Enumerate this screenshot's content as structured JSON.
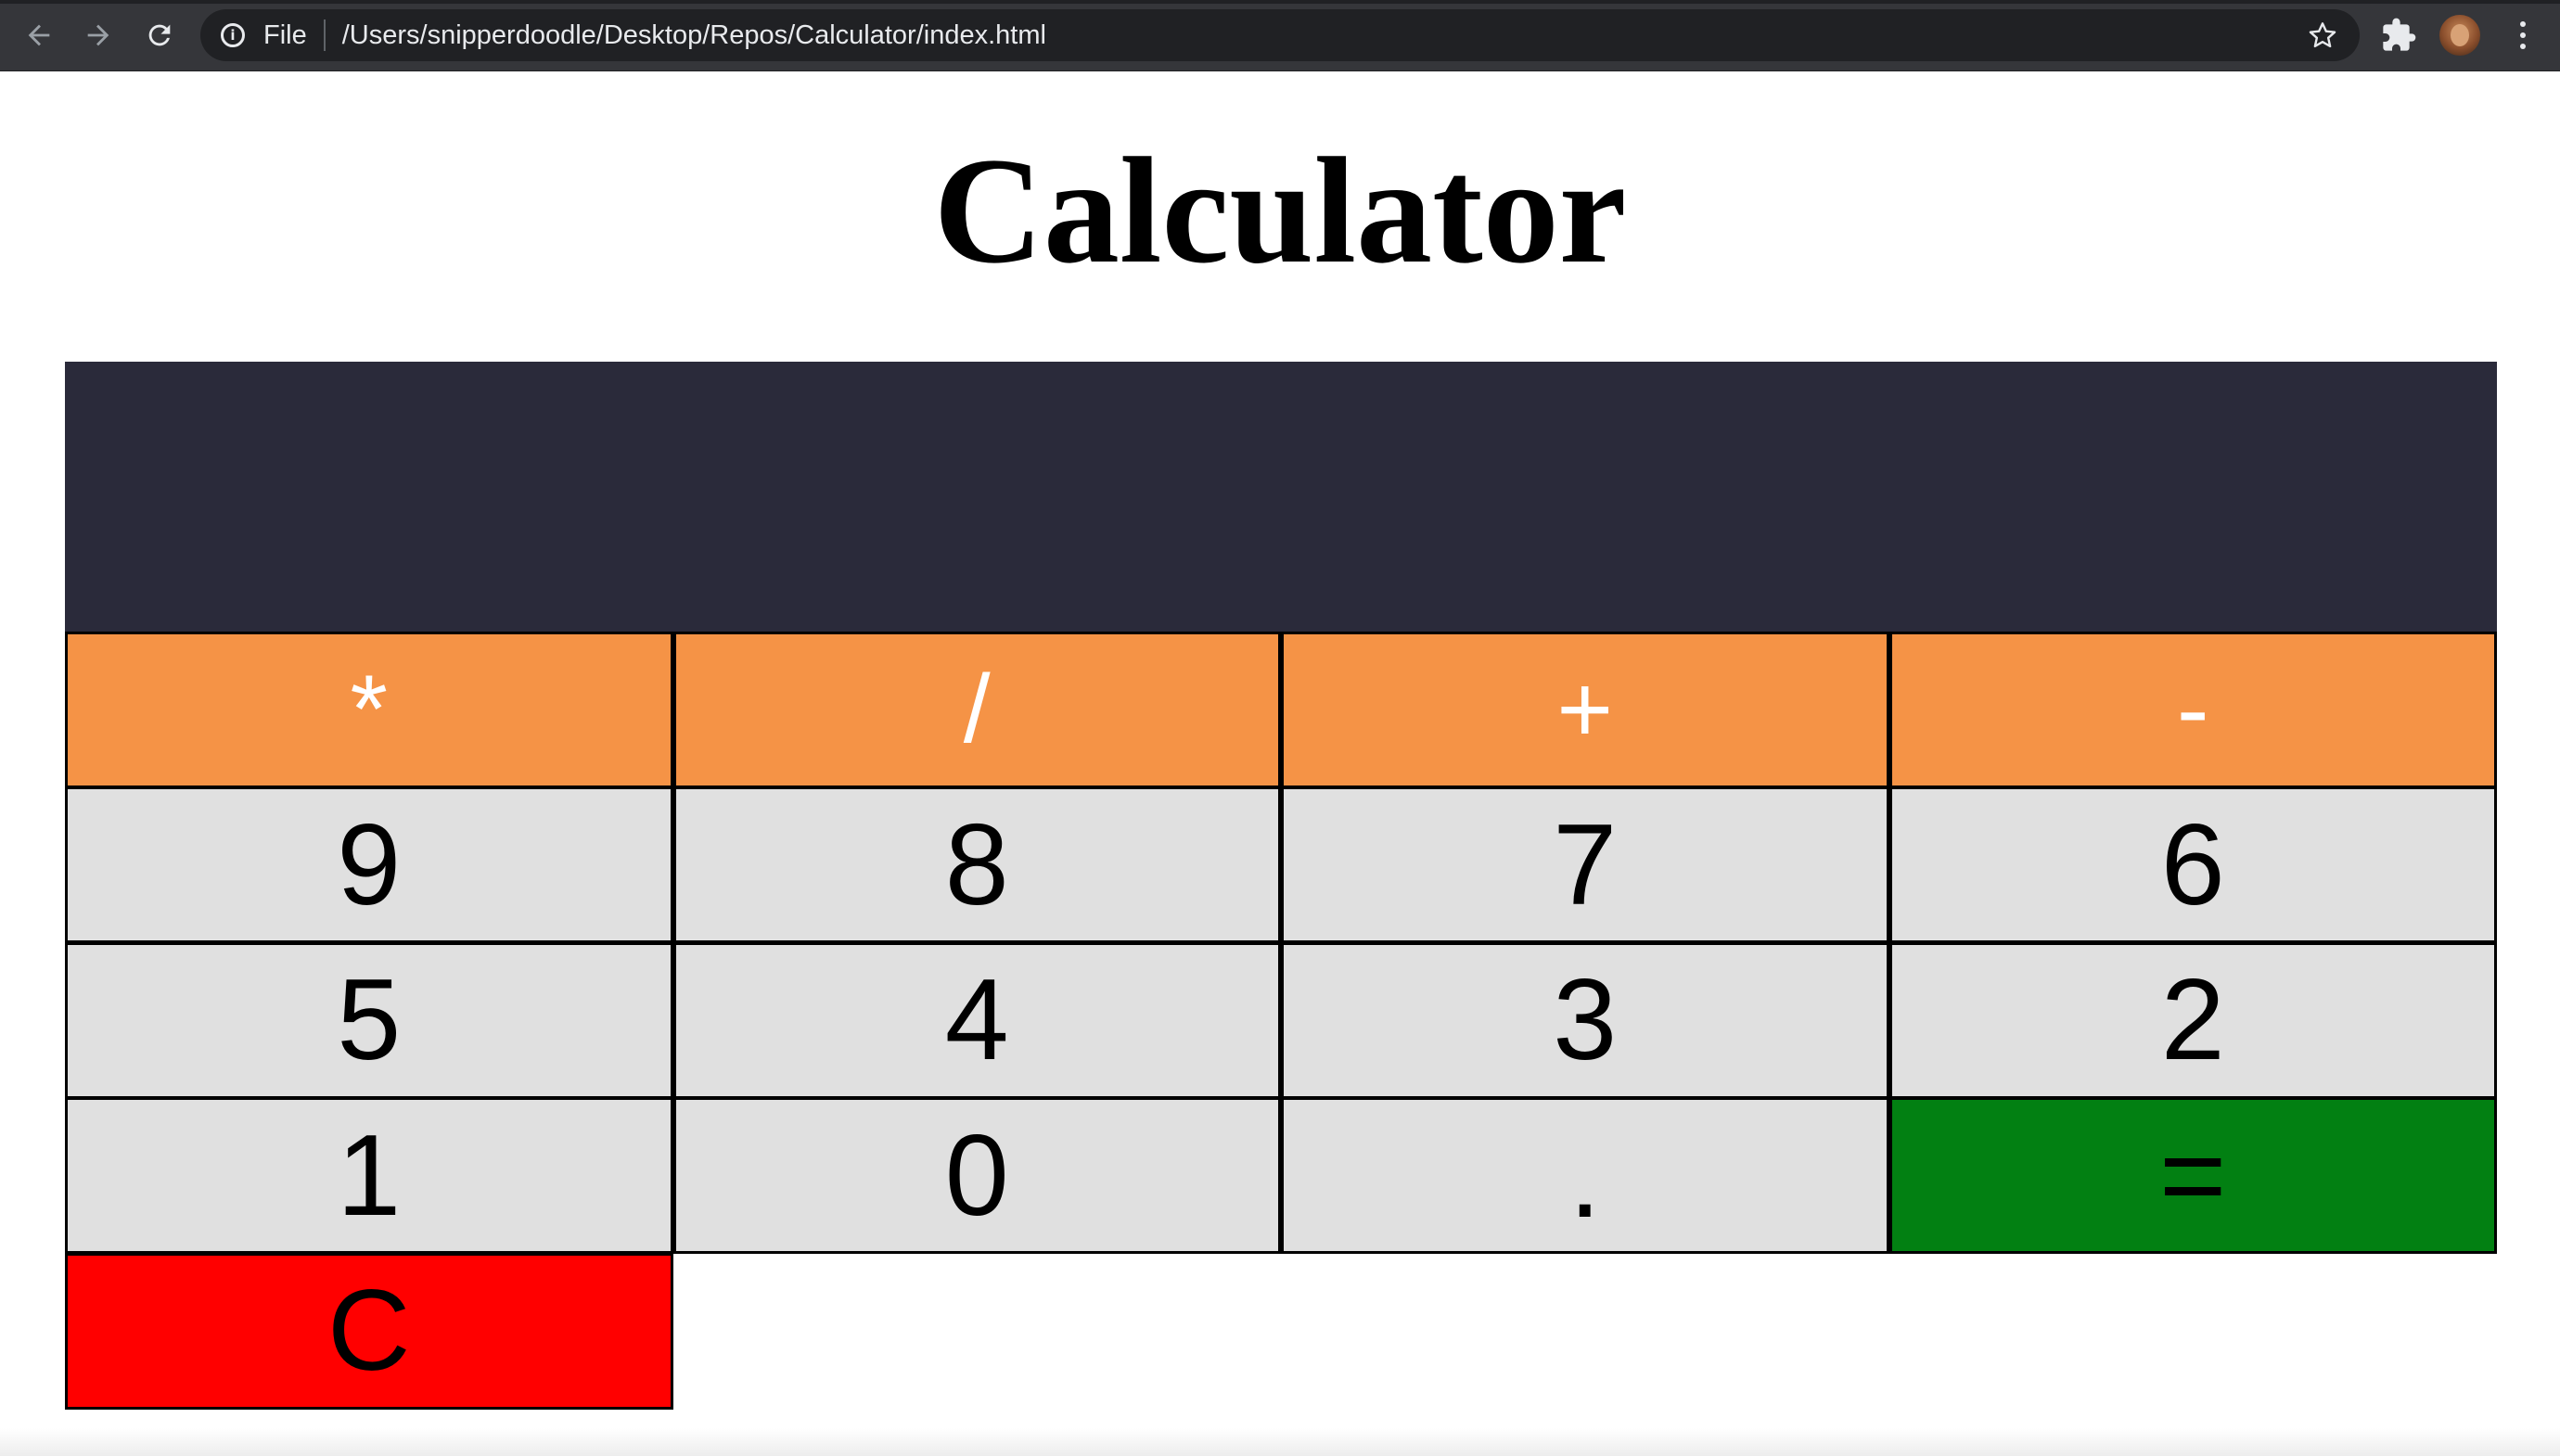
{
  "browser": {
    "file_label": "File",
    "url": "/Users/snipperdoodle/Desktop/Repos/Calculator/index.html",
    "back_icon": "arrow-left-icon",
    "forward_icon": "arrow-right-icon",
    "reload_icon": "reload-icon",
    "info_icon": "info-icon",
    "star_icon": "star-icon",
    "extensions_icon": "puzzle-icon",
    "menu_icon": "three-dots-vertical-icon"
  },
  "page": {
    "title": "Calculator"
  },
  "calculator": {
    "display_value": "",
    "operators": [
      "*",
      "/",
      "+",
      "-"
    ],
    "digits": [
      [
        "9",
        "8",
        "7",
        "6"
      ],
      [
        "5",
        "4",
        "3",
        "2"
      ],
      [
        "1",
        "0",
        "."
      ]
    ],
    "equals": "=",
    "clear": "C",
    "colors": {
      "display": "#2a2a3a",
      "operator": "#f59346",
      "digit": "#e0e0e0",
      "equals": "#028012",
      "clear": "#ff0000"
    }
  }
}
